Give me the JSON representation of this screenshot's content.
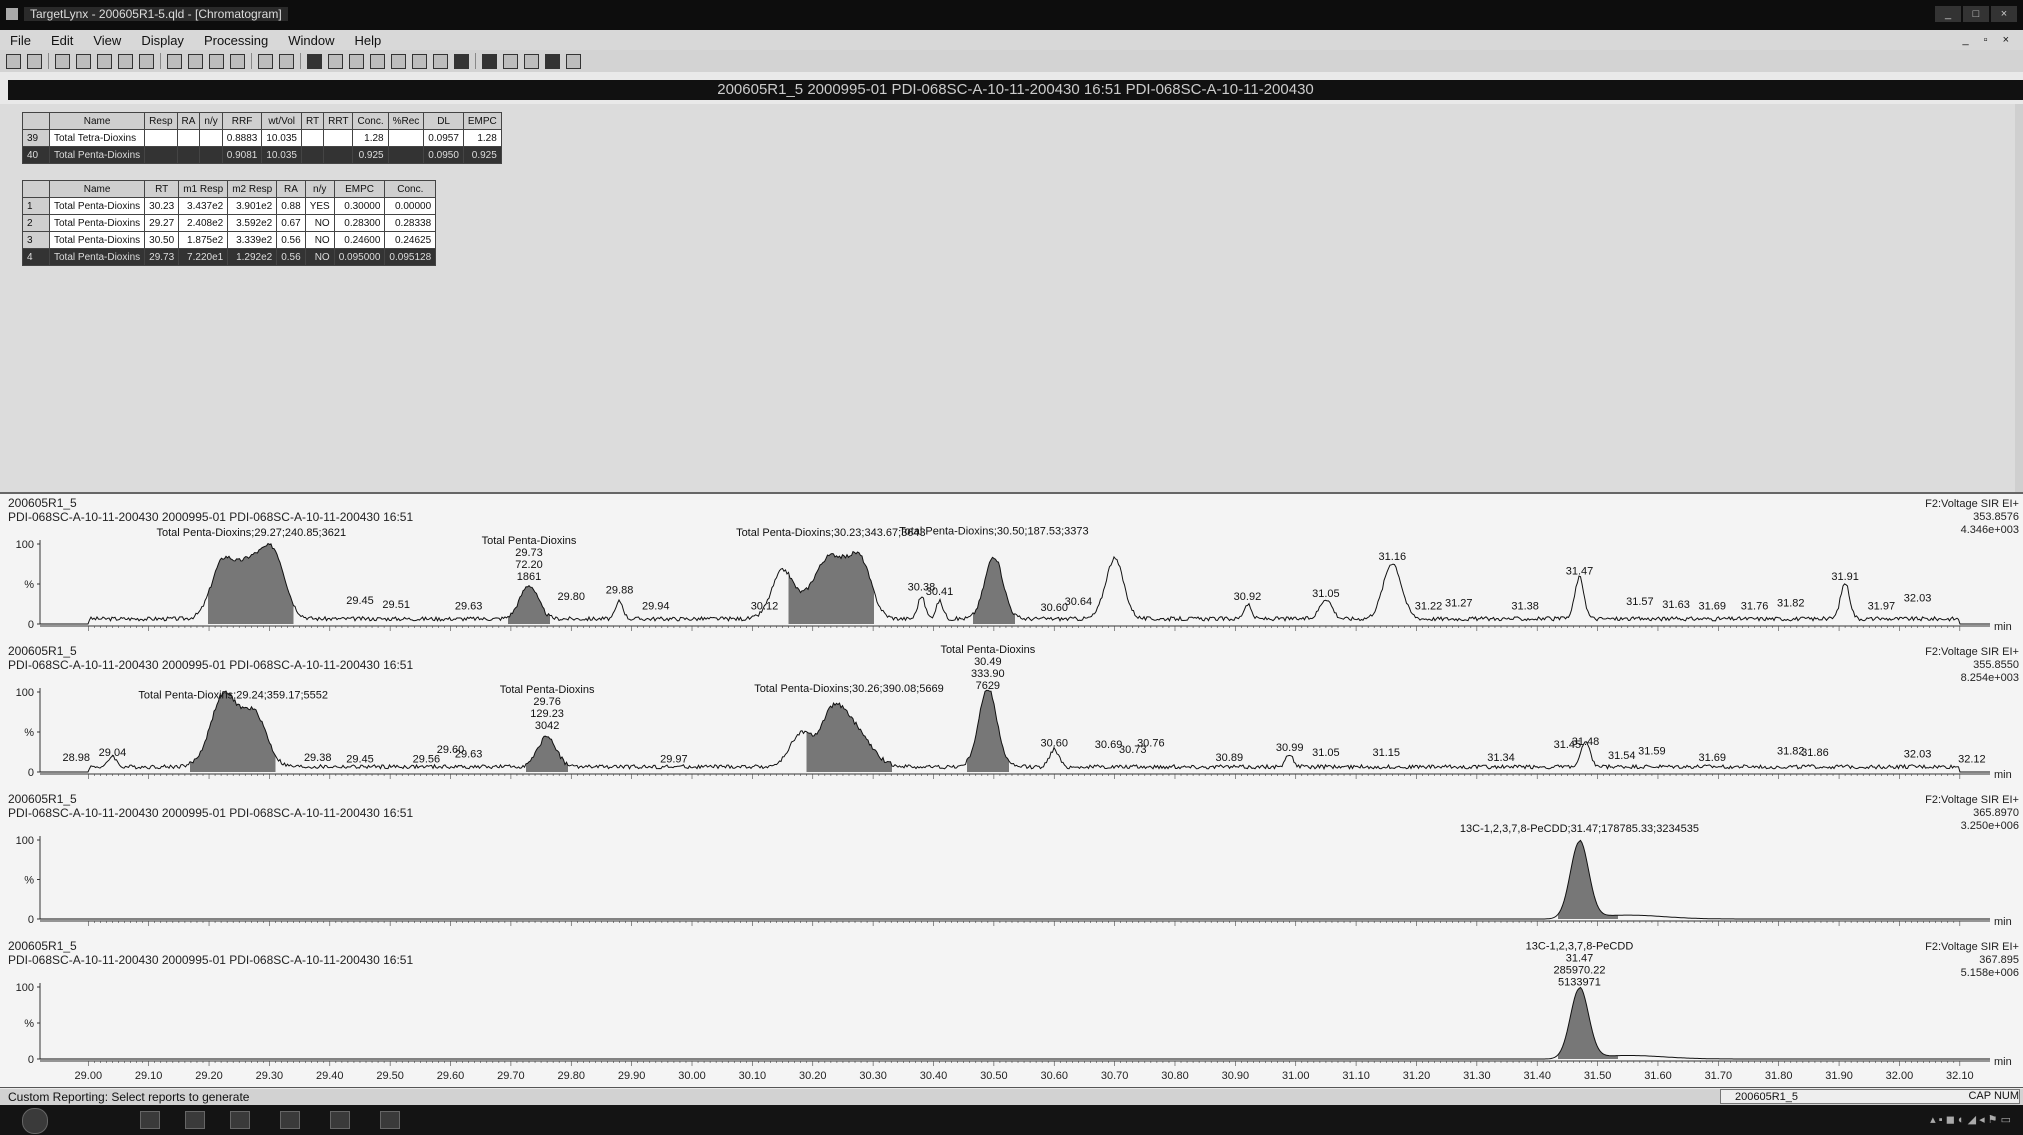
{
  "window": {
    "title": "TargetLynx - 200605R1-5.qld - [Chromatogram]",
    "controls": [
      "_",
      "□",
      "×"
    ]
  },
  "menu": [
    "File",
    "Edit",
    "View",
    "Display",
    "Processing",
    "Window",
    "Help"
  ],
  "sample_header": "200605R1_5   2000995-01 PDI-068SC-A-10-11-200430 16:51   PDI-068SC-A-10-11-200430",
  "summary_table": {
    "columns": [
      "",
      "Name",
      "Resp",
      "RA",
      "n/y",
      "RRF",
      "wt/Vol",
      "RT",
      "RRT",
      "Conc.",
      "%Rec",
      "DL",
      "EMPC"
    ],
    "rows": [
      [
        "39",
        "Total Tetra-Dioxins",
        "",
        "",
        "",
        "0.8883",
        "10.035",
        "",
        "",
        "1.28",
        "",
        "0.0957",
        "1.28"
      ],
      [
        "40",
        "Total Penta-Dioxins",
        "",
        "",
        "",
        "0.9081",
        "10.035",
        "",
        "",
        "0.925",
        "",
        "0.0950",
        "0.925"
      ]
    ]
  },
  "peak_table": {
    "columns": [
      "",
      "Name",
      "RT",
      "m1 Resp",
      "m2 Resp",
      "RA",
      "n/y",
      "EMPC",
      "Conc."
    ],
    "rows": [
      [
        "1",
        "Total Penta-Dioxins",
        "30.23",
        "3.437e2",
        "3.901e2",
        "0.88",
        "YES",
        "0.30000",
        "0.00000"
      ],
      [
        "2",
        "Total Penta-Dioxins",
        "29.27",
        "2.408e2",
        "3.592e2",
        "0.67",
        "NO",
        "0.28300",
        "0.28338"
      ],
      [
        "3",
        "Total Penta-Dioxins",
        "30.50",
        "1.875e2",
        "3.339e2",
        "0.56",
        "NO",
        "0.24600",
        "0.24625"
      ],
      [
        "4",
        "Total Penta-Dioxins",
        "29.73",
        "7.220e1",
        "1.292e2",
        "0.56",
        "NO",
        "0.095000",
        "0.095128"
      ]
    ]
  },
  "traces": [
    {
      "sample": "200605R1_5",
      "desc": "PDI-068SC-A-10-11-200430 2000995-01 PDI-068SC-A-10-11-200430 16:51",
      "function": "F2:Voltage SIR EI+",
      "mass": "353.8576",
      "intensity": "4.346e+003",
      "peaks": [
        {
          "rt": 29.27,
          "h": 0.92,
          "w": 0.06,
          "fill": true,
          "shoulders": [
            29.22,
            29.31
          ]
        },
        {
          "rt": 29.73,
          "h": 0.42,
          "w": 0.03,
          "fill": true
        },
        {
          "rt": 30.23,
          "h": 0.98,
          "w": 0.06,
          "fill": true,
          "shoulders": [
            30.15,
            30.28
          ]
        },
        {
          "rt": 30.5,
          "h": 0.78,
          "w": 0.03,
          "fill": true
        },
        {
          "rt": 30.7,
          "h": 0.75,
          "w": 0.03
        },
        {
          "rt": 31.16,
          "h": 0.7,
          "w": 0.03
        },
        {
          "rt": 31.47,
          "h": 0.52,
          "w": 0.015
        },
        {
          "rt": 31.91,
          "h": 0.45,
          "w": 0.015
        },
        {
          "rt": 31.05,
          "h": 0.25,
          "w": 0.02
        },
        {
          "rt": 30.38,
          "h": 0.28,
          "w": 0.012
        },
        {
          "rt": 30.41,
          "h": 0.22,
          "w": 0.012
        },
        {
          "rt": 29.88,
          "h": 0.22,
          "w": 0.012
        },
        {
          "rt": 30.92,
          "h": 0.18,
          "w": 0.012
        }
      ],
      "labels": [
        {
          "rt": 29.27,
          "text": [
            "Total Penta-Dioxins;29.27;240.85;3621"
          ],
          "level": 1.1
        },
        {
          "rt": 29.45,
          "text": [
            "29.45"
          ],
          "level": 0.25
        },
        {
          "rt": 29.51,
          "text": [
            "29.51"
          ],
          "level": 0.2
        },
        {
          "rt": 29.63,
          "text": [
            "29.63"
          ],
          "level": 0.18
        },
        {
          "rt": 29.73,
          "text": [
            "Total Penta-Dioxins",
            "29.73",
            "72.20",
            "1861"
          ],
          "level": 0.55
        },
        {
          "rt": 29.8,
          "text": [
            "29.80"
          ],
          "level": 0.3
        },
        {
          "rt": 29.88,
          "text": [
            "29.88"
          ],
          "level": 0.38
        },
        {
          "rt": 29.94,
          "text": [
            "29.94"
          ],
          "level": 0.18
        },
        {
          "rt": 30.12,
          "text": [
            "30.12"
          ],
          "level": 0.18
        },
        {
          "rt": 30.23,
          "text": [
            "Total Penta-Dioxins;30.23;343.67;3643"
          ],
          "level": 1.1
        },
        {
          "rt": 30.38,
          "text": [
            "30.38"
          ],
          "level": 0.42
        },
        {
          "rt": 30.41,
          "text": [
            "30.41"
          ],
          "level": 0.36
        },
        {
          "rt": 30.5,
          "text": [
            "Total Penta-Dioxins;30.50;187.53;3373"
          ],
          "level": 1.12
        },
        {
          "rt": 30.6,
          "text": [
            "30.60"
          ],
          "level": 0.16
        },
        {
          "rt": 30.64,
          "text": [
            "30.64"
          ],
          "level": 0.24
        },
        {
          "rt": 30.92,
          "text": [
            "30.92"
          ],
          "level": 0.3
        },
        {
          "rt": 31.05,
          "text": [
            "31.05"
          ],
          "level": 0.34
        },
        {
          "rt": 31.16,
          "text": [
            "31.16"
          ],
          "level": 0.8
        },
        {
          "rt": 31.22,
          "text": [
            "31.22"
          ],
          "level": 0.18
        },
        {
          "rt": 31.27,
          "text": [
            "31.27"
          ],
          "level": 0.22
        },
        {
          "rt": 31.38,
          "text": [
            "31.38"
          ],
          "level": 0.18
        },
        {
          "rt": 31.47,
          "text": [
            "31.47"
          ],
          "level": 0.62
        },
        {
          "rt": 31.57,
          "text": [
            "31.57"
          ],
          "level": 0.24
        },
        {
          "rt": 31.63,
          "text": [
            "31.63"
          ],
          "level": 0.2
        },
        {
          "rt": 31.69,
          "text": [
            "31.69"
          ],
          "level": 0.18
        },
        {
          "rt": 31.76,
          "text": [
            "31.76"
          ],
          "level": 0.18
        },
        {
          "rt": 31.82,
          "text": [
            "31.82"
          ],
          "level": 0.22
        },
        {
          "rt": 31.91,
          "text": [
            "31.91"
          ],
          "level": 0.55
        },
        {
          "rt": 31.97,
          "text": [
            "31.97"
          ],
          "level": 0.18
        },
        {
          "rt": 32.03,
          "text": [
            "32.03"
          ],
          "level": 0.28
        }
      ]
    },
    {
      "sample": "200605R1_5",
      "desc": "PDI-068SC-A-10-11-200430 2000995-01 PDI-068SC-A-10-11-200430 16:51",
      "function": "F2:Voltage SIR EI+",
      "mass": "355.8550",
      "intensity": "8.254e+003",
      "peaks": [
        {
          "rt": 29.24,
          "h": 0.72,
          "w": 0.06,
          "fill": true,
          "shoulders": [
            29.22,
            29.28
          ]
        },
        {
          "rt": 29.76,
          "h": 0.38,
          "w": 0.03,
          "fill": true
        },
        {
          "rt": 30.26,
          "h": 0.68,
          "w": 0.06,
          "fill": true,
          "shoulders": [
            30.18,
            30.23
          ]
        },
        {
          "rt": 30.49,
          "h": 0.98,
          "w": 0.03,
          "fill": true
        },
        {
          "rt": 30.6,
          "h": 0.22,
          "w": 0.015
        },
        {
          "rt": 31.48,
          "h": 0.3,
          "w": 0.015
        },
        {
          "rt": 30.99,
          "h": 0.16,
          "w": 0.012
        },
        {
          "rt": 29.04,
          "h": 0.14,
          "w": 0.012
        }
      ],
      "labels": [
        {
          "rt": 28.98,
          "text": [
            "28.98"
          ],
          "level": 0.14
        },
        {
          "rt": 29.04,
          "text": [
            "29.04"
          ],
          "level": 0.2
        },
        {
          "rt": 29.24,
          "text": [
            "Total Penta-Dioxins;29.24;359.17;5552"
          ],
          "level": 0.92
        },
        {
          "rt": 29.38,
          "text": [
            "29.38"
          ],
          "level": 0.14
        },
        {
          "rt": 29.45,
          "text": [
            "29.45"
          ],
          "level": 0.12
        },
        {
          "rt": 29.56,
          "text": [
            "29.56"
          ],
          "level": 0.12
        },
        {
          "rt": 29.6,
          "text": [
            "29.60"
          ],
          "level": 0.24
        },
        {
          "rt": 29.63,
          "text": [
            "29.63"
          ],
          "level": 0.18
        },
        {
          "rt": 29.76,
          "text": [
            "Total Penta-Dioxins",
            "29.76",
            "129.23",
            "3042"
          ],
          "level": 0.54
        },
        {
          "rt": 29.97,
          "text": [
            "29.97"
          ],
          "level": 0.12
        },
        {
          "rt": 30.26,
          "text": [
            "Total Penta-Dioxins;30.26;390.08;5669"
          ],
          "level": 1.0
        },
        {
          "rt": 30.49,
          "text": [
            "Total Penta-Dioxins",
            "30.49",
            "333.90",
            "7629"
          ],
          "level": 1.04
        },
        {
          "rt": 30.6,
          "text": [
            "30.60"
          ],
          "level": 0.32
        },
        {
          "rt": 30.69,
          "text": [
            "30.69"
          ],
          "level": 0.3
        },
        {
          "rt": 30.73,
          "text": [
            "30.73"
          ],
          "level": 0.24
        },
        {
          "rt": 30.76,
          "text": [
            "30.76"
          ],
          "level": 0.32
        },
        {
          "rt": 30.89,
          "text": [
            "30.89"
          ],
          "level": 0.14
        },
        {
          "rt": 30.99,
          "text": [
            "30.99"
          ],
          "level": 0.26
        },
        {
          "rt": 31.05,
          "text": [
            "31.05"
          ],
          "level": 0.2
        },
        {
          "rt": 31.15,
          "text": [
            "31.15"
          ],
          "level": 0.2
        },
        {
          "rt": 31.34,
          "text": [
            "31.34"
          ],
          "level": 0.14
        },
        {
          "rt": 31.45,
          "text": [
            "31.45"
          ],
          "level": 0.3
        },
        {
          "rt": 31.48,
          "text": [
            "31.48"
          ],
          "level": 0.34
        },
        {
          "rt": 31.54,
          "text": [
            "31.54"
          ],
          "level": 0.16
        },
        {
          "rt": 31.59,
          "text": [
            "31.59"
          ],
          "level": 0.22
        },
        {
          "rt": 31.69,
          "text": [
            "31.69"
          ],
          "level": 0.14
        },
        {
          "rt": 31.82,
          "text": [
            "31.82"
          ],
          "level": 0.22
        },
        {
          "rt": 31.86,
          "text": [
            "31.86"
          ],
          "level": 0.2
        },
        {
          "rt": 32.03,
          "text": [
            "32.03"
          ],
          "level": 0.18
        },
        {
          "rt": 32.12,
          "text": [
            "32.12"
          ],
          "level": 0.12
        }
      ]
    },
    {
      "sample": "200605R1_5",
      "desc": "PDI-068SC-A-10-11-200430 2000995-01 PDI-068SC-A-10-11-200430 16:51",
      "function": "F2:Voltage SIR EI+",
      "mass": "365.8970",
      "intensity": "3.250e+006",
      "peaks": [
        {
          "rt": 31.47,
          "h": 0.98,
          "w": 0.03,
          "fill": true,
          "tail": true
        }
      ],
      "labels": [
        {
          "rt": 31.47,
          "text": [
            "13C-1,2,3,7,8-PeCDD;31.47;178785.33;3234535"
          ],
          "level": 1.1
        }
      ]
    },
    {
      "sample": "200605R1_5",
      "desc": "PDI-068SC-A-10-11-200430 2000995-01 PDI-068SC-A-10-11-200430 16:51",
      "function": "F2:Voltage SIR EI+",
      "mass": "367.895",
      "intensity": "5.158e+006",
      "peaks": [
        {
          "rt": 31.47,
          "h": 0.98,
          "w": 0.03,
          "fill": true,
          "tail": true
        }
      ],
      "labels": [
        {
          "rt": 31.47,
          "text": [
            "13C-1,2,3,7,8-PeCDD",
            "31.47",
            "285970.22",
            "5133971"
          ],
          "level": 1.02
        }
      ]
    }
  ],
  "axis": {
    "y_ticks": [
      "100",
      "%",
      "0"
    ],
    "x_ticks": [
      "29.00",
      "29.10",
      "29.20",
      "29.30",
      "29.40",
      "29.50",
      "29.60",
      "29.70",
      "29.80",
      "29.90",
      "30.00",
      "30.10",
      "30.20",
      "30.30",
      "30.40",
      "30.50",
      "30.60",
      "30.70",
      "30.80",
      "30.90",
      "31.00",
      "31.10",
      "31.20",
      "31.30",
      "31.40",
      "31.50",
      "31.60",
      "31.70",
      "31.80",
      "31.90",
      "32.00",
      "32.10"
    ],
    "unit": "min",
    "x_min": 28.92,
    "x_max": 32.15
  },
  "status": {
    "left": "Custom Reporting: Select reports to generate",
    "sample": "200605R1_5",
    "caps": "CAP  NUM"
  },
  "colors": {
    "peak_fill": "#777777",
    "trace_line": "#111111",
    "header_band": "#111111"
  }
}
